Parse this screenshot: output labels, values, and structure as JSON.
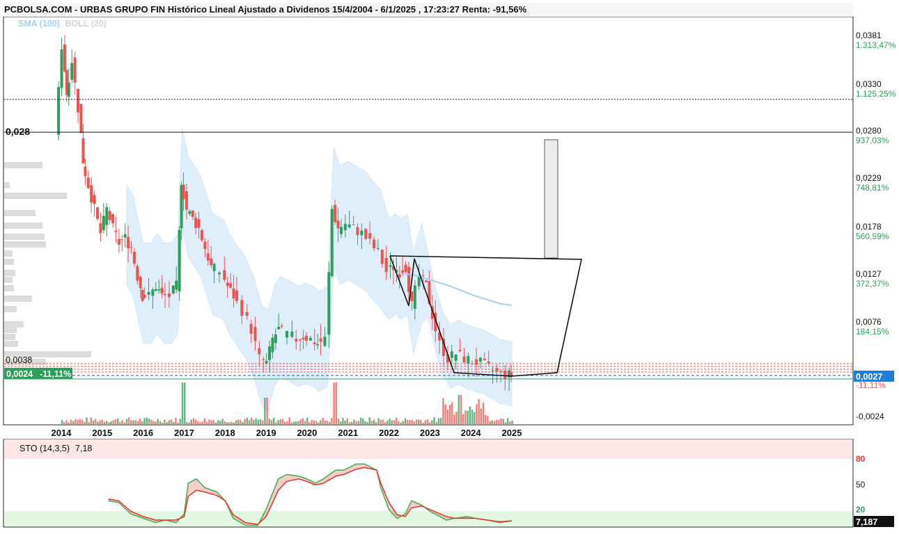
{
  "title": "PCBOLSA.COM - URBAS GRUPO FIN Histórico Lineal Ajustado a Dividenos 15/4/2004 - 6/1/2025 , 17:23:27 Renta: -91,56%",
  "indicators": {
    "sma_label": "SMA (100)",
    "boll_label": "BOLL (20)"
  },
  "sto": {
    "label": "STO (14,3,5)",
    "value": "7,18",
    "readout": "7,187",
    "levels": [
      "80",
      "50",
      "20"
    ]
  },
  "price_axis": {
    "ticks": [
      {
        "price": "0,0381",
        "pct": "1.313,47%"
      },
      {
        "price": "0,0330",
        "pct": "1.125,25%"
      },
      {
        "price": "0,0280",
        "pct": "937,03%"
      },
      {
        "price": "0,0229",
        "pct": "748,81%"
      },
      {
        "price": "0,0178",
        "pct": "560,59%"
      },
      {
        "price": "0,0127",
        "pct": "372,37%"
      },
      {
        "price": "0,0076",
        "pct": "184,15%"
      },
      {
        "price": "-0,0024",
        "pct": ""
      }
    ],
    "current_price": "0,0027",
    "current_pct": "-11,11%"
  },
  "left_labels": {
    "level_028": "0,028",
    "level_0038": "0,0038",
    "current": "0,0024",
    "current_pct": "-11,11%"
  },
  "colors": {
    "up": "#2e9e5b",
    "down": "#ef5350",
    "band": "#d9ecfb",
    "sma": "#9fd2ee",
    "sto_k": "#4caf50",
    "sto_d": "#e53935"
  },
  "chart_data": {
    "type": "line",
    "title": "PCBOLSA.COM - URBAS GRUPO FIN Histórico Lineal Ajustado a Dividenos 15/4/2004 - 6/1/2025",
    "x_ticks": [
      "2014",
      "2015",
      "2016",
      "2017",
      "2018",
      "2019",
      "2020",
      "2021",
      "2022",
      "2023",
      "2024",
      "2025"
    ],
    "ylim": [
      -0.0024,
      0.04
    ],
    "horizontal_levels": [
      0.028,
      0.0314,
      0.0038,
      0.0027
    ],
    "series": [
      {
        "values": [
          [
            2013.9,
            0.0275
          ],
          [
            2014.05,
            0.037
          ],
          [
            2014.15,
            0.032
          ],
          [
            2014.3,
            0.0355
          ],
          [
            2014.45,
            0.0305
          ],
          [
            2014.55,
            0.025
          ],
          [
            2014.7,
            0.0225
          ],
          [
            2014.85,
            0.02
          ],
          [
            2015.0,
            0.0175
          ],
          [
            2015.15,
            0.02
          ],
          [
            2015.3,
            0.018
          ],
          [
            2015.45,
            0.0165
          ],
          [
            2015.6,
            0.017
          ],
          [
            2015.75,
            0.016
          ],
          [
            2015.9,
            0.013
          ],
          [
            2016.0,
            0.011
          ],
          [
            2016.2,
            0.011
          ],
          [
            2016.35,
            0.012
          ],
          [
            2016.5,
            0.011
          ],
          [
            2016.7,
            0.011
          ],
          [
            2016.85,
            0.012
          ],
          [
            2016.95,
            0.023
          ],
          [
            2017.1,
            0.02
          ],
          [
            2017.25,
            0.019
          ],
          [
            2017.4,
            0.018
          ],
          [
            2017.55,
            0.016
          ],
          [
            2017.7,
            0.014
          ],
          [
            2017.95,
            0.0135
          ],
          [
            2018.1,
            0.012
          ],
          [
            2018.25,
            0.011
          ],
          [
            2018.5,
            0.0095
          ],
          [
            2018.7,
            0.0075
          ],
          [
            2018.9,
            0.0045
          ],
          [
            2019.05,
            0.004
          ],
          [
            2019.2,
            0.0065
          ],
          [
            2019.35,
            0.0075
          ],
          [
            2019.6,
            0.007
          ],
          [
            2019.8,
            0.0065
          ],
          [
            2019.95,
            0.0068
          ],
          [
            2020.15,
            0.0065
          ],
          [
            2020.3,
            0.006
          ],
          [
            2020.5,
            0.0065
          ],
          [
            2020.65,
            0.02
          ],
          [
            2020.8,
            0.018
          ],
          [
            2021.0,
            0.0185
          ],
          [
            2021.2,
            0.018
          ],
          [
            2021.4,
            0.0175
          ],
          [
            2021.6,
            0.0165
          ],
          [
            2021.8,
            0.0155
          ],
          [
            2022.0,
            0.0135
          ],
          [
            2022.15,
            0.014
          ],
          [
            2022.3,
            0.0135
          ],
          [
            2022.45,
            0.014
          ],
          [
            2022.6,
            0.01
          ],
          [
            2022.8,
            0.013
          ],
          [
            2022.95,
            0.012
          ],
          [
            2023.1,
            0.009
          ],
          [
            2023.3,
            0.006
          ],
          [
            2023.5,
            0.0045
          ],
          [
            2023.7,
            0.005
          ],
          [
            2023.9,
            0.0045
          ],
          [
            2024.1,
            0.0042
          ],
          [
            2024.3,
            0.004
          ],
          [
            2024.5,
            0.0035
          ],
          [
            2024.7,
            0.003
          ],
          [
            2024.9,
            0.0028
          ],
          [
            2025.0,
            0.0027
          ]
        ]
      },
      {
        "values": [
          [
            2022.3,
            0.0133
          ],
          [
            2022.6,
            0.0132
          ],
          [
            2022.9,
            0.0128
          ],
          [
            2023.2,
            0.0124
          ],
          [
            2023.5,
            0.012
          ],
          [
            2023.8,
            0.0115
          ],
          [
            2024.1,
            0.011
          ],
          [
            2024.4,
            0.0106
          ],
          [
            2024.7,
            0.0102
          ],
          [
            2025.0,
            0.01
          ]
        ]
      }
    ],
    "sto_ylim": [
      0,
      100
    ],
    "sto_series": [
      {
        "values": [
          [
            2015.15,
            30
          ],
          [
            2015.4,
            28
          ],
          [
            2015.7,
            15
          ],
          [
            2016.0,
            10
          ],
          [
            2016.3,
            5
          ],
          [
            2016.55,
            8
          ],
          [
            2016.8,
            5
          ],
          [
            2017.0,
            15
          ],
          [
            2017.1,
            50
          ],
          [
            2017.3,
            55
          ],
          [
            2017.5,
            45
          ],
          [
            2017.8,
            40
          ],
          [
            2018.0,
            30
          ],
          [
            2018.2,
            10
          ],
          [
            2018.5,
            2
          ],
          [
            2018.8,
            2
          ],
          [
            2019.0,
            20
          ],
          [
            2019.3,
            55
          ],
          [
            2019.5,
            60
          ],
          [
            2019.8,
            58
          ],
          [
            2020.0,
            55
          ],
          [
            2020.2,
            50
          ],
          [
            2020.4,
            55
          ],
          [
            2020.7,
            65
          ],
          [
            2020.9,
            65
          ],
          [
            2021.2,
            72
          ],
          [
            2021.4,
            72
          ],
          [
            2021.7,
            65
          ],
          [
            2021.8,
            45
          ],
          [
            2022.0,
            20
          ],
          [
            2022.2,
            10
          ],
          [
            2022.4,
            15
          ],
          [
            2022.55,
            30
          ],
          [
            2022.8,
            25
          ],
          [
            2023.0,
            18
          ],
          [
            2023.4,
            8
          ],
          [
            2023.6,
            10
          ],
          [
            2023.9,
            12
          ],
          [
            2024.1,
            10
          ],
          [
            2024.4,
            8
          ],
          [
            2024.7,
            5
          ],
          [
            2025.0,
            7.18
          ]
        ]
      },
      {
        "values": [
          [
            2015.15,
            32
          ],
          [
            2015.4,
            30
          ],
          [
            2015.7,
            18
          ],
          [
            2016.0,
            12
          ],
          [
            2016.3,
            8
          ],
          [
            2016.55,
            8
          ],
          [
            2016.8,
            8
          ],
          [
            2017.0,
            12
          ],
          [
            2017.1,
            35
          ],
          [
            2017.3,
            42
          ],
          [
            2017.5,
            40
          ],
          [
            2017.8,
            36
          ],
          [
            2018.0,
            30
          ],
          [
            2018.2,
            14
          ],
          [
            2018.5,
            5
          ],
          [
            2018.8,
            3
          ],
          [
            2019.0,
            12
          ],
          [
            2019.3,
            42
          ],
          [
            2019.5,
            52
          ],
          [
            2019.8,
            55
          ],
          [
            2020.0,
            52
          ],
          [
            2020.2,
            48
          ],
          [
            2020.4,
            50
          ],
          [
            2020.7,
            58
          ],
          [
            2020.9,
            60
          ],
          [
            2021.2,
            66
          ],
          [
            2021.4,
            68
          ],
          [
            2021.7,
            65
          ],
          [
            2021.8,
            50
          ],
          [
            2022.0,
            28
          ],
          [
            2022.2,
            14
          ],
          [
            2022.4,
            12
          ],
          [
            2022.55,
            22
          ],
          [
            2022.8,
            24
          ],
          [
            2023.0,
            20
          ],
          [
            2023.4,
            12
          ],
          [
            2023.6,
            10
          ],
          [
            2023.9,
            10
          ],
          [
            2024.1,
            10
          ],
          [
            2024.4,
            8
          ],
          [
            2024.7,
            6
          ],
          [
            2025.0,
            7
          ]
        ]
      }
    ]
  }
}
